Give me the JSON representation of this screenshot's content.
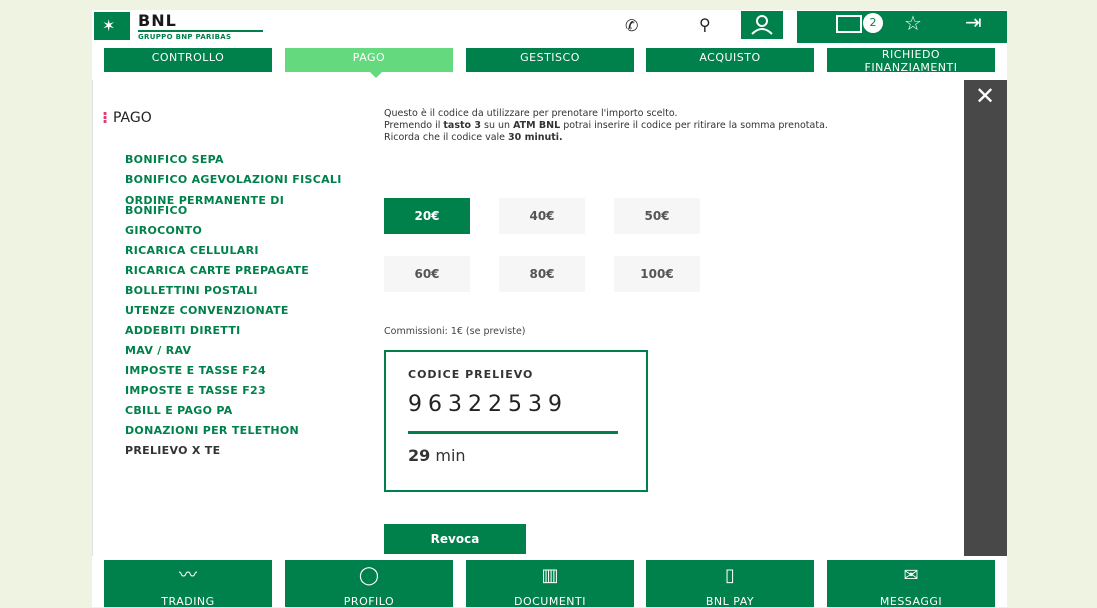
{
  "brand": {
    "name": "BNL",
    "subtitle": "GRUPPO BNP PARIBAS"
  },
  "topbar": {
    "notifications_count": "2"
  },
  "nav": [
    "CONTROLLO",
    "PAGO",
    "GESTISCO",
    "ACQUISTO",
    "RICHIEDO",
    "FINANZIAMENTI"
  ],
  "sidebar": {
    "title": "PAGO",
    "items": [
      "BONIFICO SEPA",
      "BONIFICO AGEVOLAZIONI FISCALI",
      "ORDINE PERMANENTE DI",
      "BONIFICO",
      "GIROCONTO",
      "RICARICA CELLULARI",
      "RICARICA CARTE PREPAGATE",
      "BOLLETTINI POSTALI",
      "UTENZE CONVENZIONATE",
      "ADDEBITI DIRETTI",
      "MAV / RAV",
      "IMPOSTE E TASSE F24",
      "IMPOSTE E TASSE F23",
      "CBILL E PAGO PA",
      "DONAZIONI PER TELETHON",
      "PRELIEVO X TE"
    ]
  },
  "info": {
    "line1": "Questo è il codice da utilizzare per prenotare l'importo scelto.",
    "line2a": "Premendo il ",
    "line2b": "tasto 3",
    "line2c": " su un ",
    "line2d": "ATM BNL",
    "line2e": " potrai inserire il codice per ritirare la somma prenotata.",
    "line3a": "Ricorda che il codice vale ",
    "line3b": "30 minuti."
  },
  "amounts": [
    "20€",
    "40€",
    "50€",
    "60€",
    "80€",
    "100€"
  ],
  "selected_amount": "20€",
  "commission": "Commissioni: 1€ (se previste)",
  "code": {
    "label": "CODICE PRELIEVO",
    "value": "96322539",
    "remaining_num": "29",
    "remaining_unit": "min"
  },
  "revoca_label": "Revoca",
  "tiles": [
    "TRADING",
    "PROFILO",
    "DOCUMENTI",
    "BNL PAY",
    "MESSAGGI"
  ],
  "colors": {
    "brand_green": "#00804a",
    "active_tab": "#65d97e",
    "accent_pink": "#e13b6f"
  }
}
